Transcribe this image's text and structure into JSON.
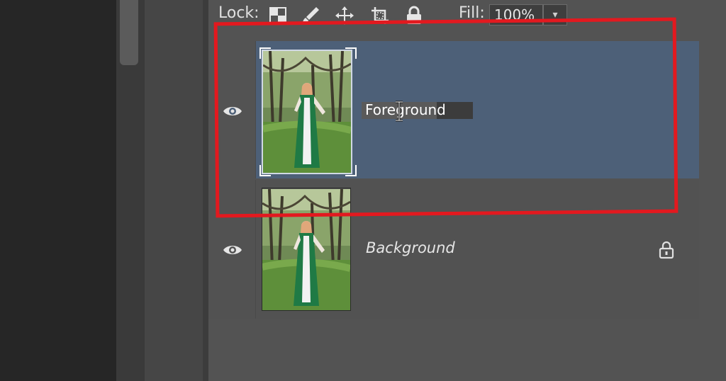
{
  "lock_bar": {
    "lock_label": "Lock:",
    "lock_icons": [
      "lock-transparent-pixels-icon",
      "lock-image-pixels-icon",
      "lock-position-icon",
      "lock-artboard-icon",
      "lock-all-icon"
    ],
    "fill_label": "Fill:",
    "fill_value": "100%"
  },
  "layers": [
    {
      "name": "Foreground",
      "editing_text": "Foreground",
      "visible": true,
      "selected": true
    },
    {
      "name": "Background",
      "visible": true,
      "locked": true
    }
  ],
  "colors": {
    "selected_row": "#4d6078",
    "annotation": "#e3191f"
  }
}
